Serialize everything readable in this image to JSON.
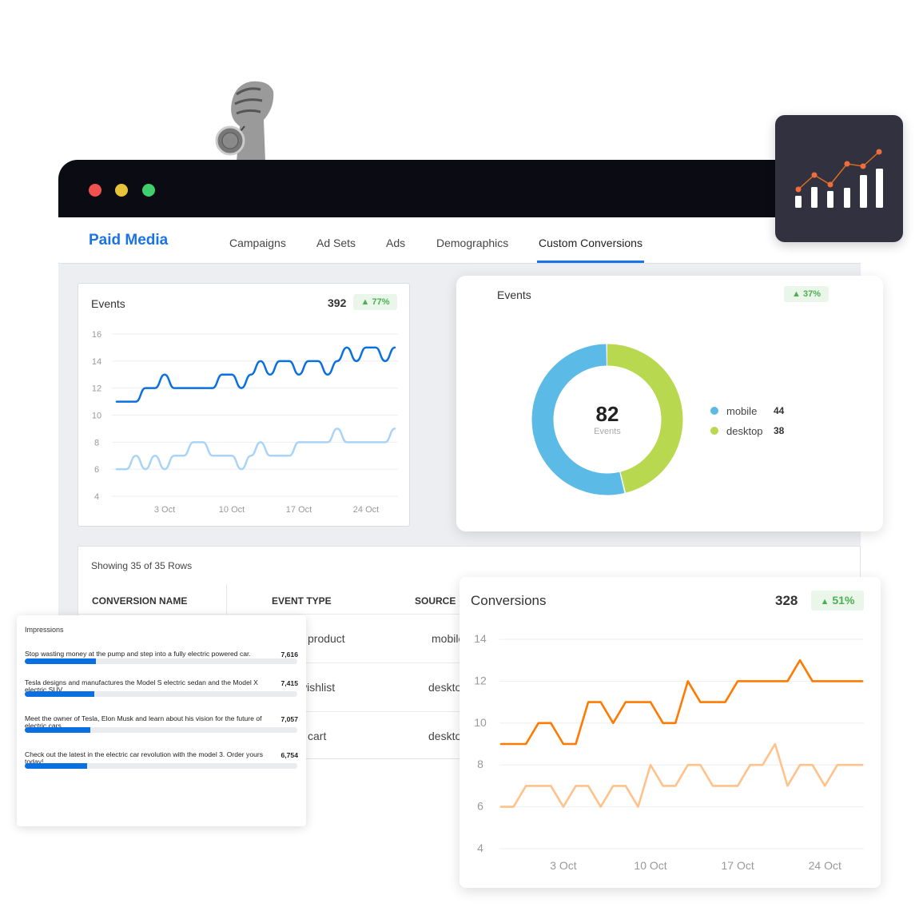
{
  "window": {
    "traffic_lights": [
      "#f0524f",
      "#e8c33a",
      "#3fcf6c"
    ]
  },
  "nav": {
    "brand": "Paid Media",
    "tabs": [
      {
        "label": "Campaigns"
      },
      {
        "label": "Ad Sets"
      },
      {
        "label": "Ads"
      },
      {
        "label": "Demographics"
      },
      {
        "label": "Custom Conversions",
        "active": true
      }
    ],
    "accent": "#1a73e8"
  },
  "events_card": {
    "title": "Events",
    "total": "392",
    "change": "77%",
    "change_direction": "up"
  },
  "donut_card": {
    "title": "Events",
    "change": "37%",
    "change_direction": "up",
    "center_value": "82",
    "center_label": "Events"
  },
  "table": {
    "showing": "Showing 35 of 35 Rows",
    "columns": [
      "CONVERSION NAME",
      "EVENT TYPE",
      "SOURCE"
    ],
    "rows": [
      {
        "event_type": "product",
        "source": "mobile"
      },
      {
        "event_type": "wishlist",
        "source": "desktop"
      },
      {
        "event_type": "cart",
        "source": "desktop"
      }
    ]
  },
  "conversions_card": {
    "title": "Conversions",
    "total": "328",
    "change": "51%",
    "change_direction": "up"
  },
  "impressions": {
    "title": "Impressions",
    "items": [
      {
        "text": "Stop wasting money at the pump and step into a fully electric powered car.",
        "value": "7,616",
        "fill": 0.26
      },
      {
        "text": "Tesla designs and manufactures the Model S electric sedan and the Model X electric SUV.",
        "value": "7,415",
        "fill": 0.255
      },
      {
        "text": "Meet the owner of Tesla, Elon Musk and learn about his vision for the future of electric cars.",
        "value": "7,057",
        "fill": 0.24
      },
      {
        "text": "Check out the latest in the electric car revolution with the model 3. Order yours today!",
        "value": "6,754",
        "fill": 0.23
      }
    ]
  },
  "icons": {
    "app_badge": "bar-chart-trend-icon",
    "hero_image": "hand-holding-medal"
  },
  "chart_data": [
    {
      "type": "line",
      "ylim": [
        4,
        16
      ],
      "yticks": [
        4,
        6,
        8,
        10,
        12,
        14,
        16
      ],
      "grid": true,
      "x": [
        "28 Sep",
        "29 Sep",
        "30 Sep",
        "1 Oct",
        "2 Oct",
        "3 Oct",
        "4 Oct",
        "5 Oct",
        "6 Oct",
        "7 Oct",
        "8 Oct",
        "9 Oct",
        "10 Oct",
        "11 Oct",
        "12 Oct",
        "13 Oct",
        "14 Oct",
        "15 Oct",
        "16 Oct",
        "17 Oct",
        "18 Oct",
        "19 Oct",
        "20 Oct",
        "21 Oct",
        "22 Oct",
        "23 Oct",
        "24 Oct",
        "25 Oct",
        "26 Oct",
        "27 Oct"
      ],
      "xticks": [
        "3 Oct",
        "10 Oct",
        "17 Oct",
        "24 Oct"
      ],
      "series": [
        {
          "color": "#0a6fe0",
          "values": [
            11,
            11,
            11,
            12,
            12,
            13,
            12,
            12,
            12,
            12,
            12,
            13,
            13,
            12,
            13,
            14,
            13,
            14,
            14,
            13,
            14,
            14,
            13,
            14,
            15,
            14,
            15,
            15,
            14,
            15
          ]
        },
        {
          "color": "#a9d3f7",
          "values": [
            6,
            6,
            7,
            6,
            7,
            6,
            7,
            7,
            8,
            8,
            7,
            7,
            7,
            6,
            7,
            8,
            7,
            7,
            7,
            8,
            8,
            8,
            8,
            9,
            8,
            8,
            8,
            8,
            8,
            9
          ]
        }
      ]
    },
    {
      "type": "pie",
      "donut": true,
      "total": 82,
      "slices": [
        {
          "label": "desktop",
          "value": 38,
          "color": "#b8d94f"
        },
        {
          "label": "mobile",
          "value": 44,
          "color": "#5bbbe6"
        }
      ],
      "legend": "right"
    },
    {
      "type": "line",
      "ylim": [
        4,
        14
      ],
      "yticks": [
        4,
        6,
        8,
        10,
        12,
        14
      ],
      "grid": true,
      "x": [
        "28 Sep",
        "29 Sep",
        "30 Sep",
        "1 Oct",
        "2 Oct",
        "3 Oct",
        "4 Oct",
        "5 Oct",
        "6 Oct",
        "7 Oct",
        "8 Oct",
        "9 Oct",
        "10 Oct",
        "11 Oct",
        "12 Oct",
        "13 Oct",
        "14 Oct",
        "15 Oct",
        "16 Oct",
        "17 Oct",
        "18 Oct",
        "19 Oct",
        "20 Oct",
        "21 Oct",
        "22 Oct",
        "23 Oct",
        "24 Oct",
        "25 Oct",
        "26 Oct",
        "27 Oct"
      ],
      "xticks": [
        "3 Oct",
        "10 Oct",
        "17 Oct",
        "24 Oct"
      ],
      "series": [
        {
          "color": "#ff7a00",
          "values": [
            9,
            9,
            9,
            10,
            10,
            9,
            9,
            11,
            11,
            10,
            11,
            11,
            11,
            10,
            10,
            12,
            11,
            11,
            11,
            12,
            12,
            12,
            12,
            12,
            13,
            12,
            12,
            12,
            12,
            12
          ]
        },
        {
          "color": "#ffc28a",
          "values": [
            6,
            6,
            7,
            7,
            7,
            6,
            7,
            7,
            6,
            7,
            7,
            6,
            8,
            7,
            7,
            8,
            8,
            7,
            7,
            7,
            8,
            8,
            9,
            7,
            8,
            8,
            7,
            8,
            8,
            8
          ]
        }
      ]
    }
  ]
}
